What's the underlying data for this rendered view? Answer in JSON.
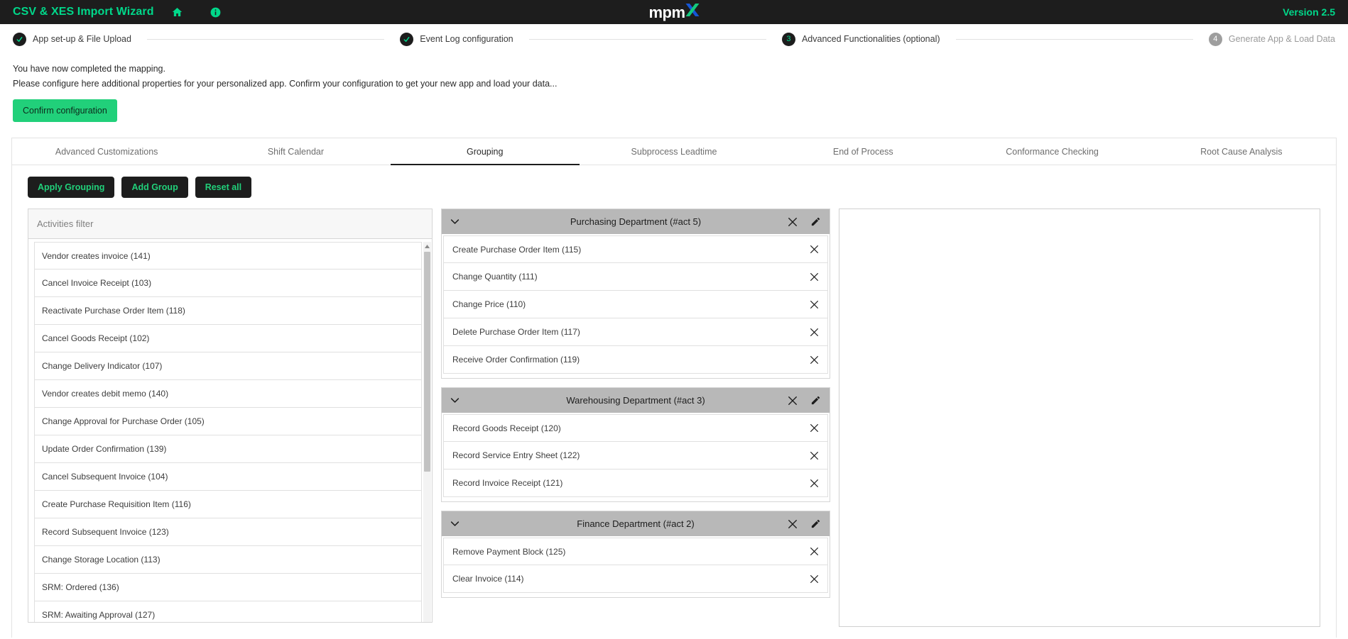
{
  "topbar": {
    "app_title": "CSV & XES Import Wizard",
    "home_icon": "home-icon",
    "info_icon": "info-icon",
    "logo_text": "mpm",
    "logo_x": "X",
    "version": "Version 2.5",
    "bg_color": "#1d1d1d",
    "accent_color": "#00d88a"
  },
  "stepper": {
    "steps": [
      {
        "marker": "✓",
        "label": "App set-up & File Upload",
        "state": "done"
      },
      {
        "marker": "✓",
        "label": "Event Log configuration",
        "state": "done"
      },
      {
        "marker": "3",
        "label": "Advanced Functionalities (optional)",
        "state": "current"
      },
      {
        "marker": "4",
        "label": "Generate App & Load Data",
        "state": "upcoming"
      }
    ]
  },
  "intro": {
    "line1": "You have now completed the mapping.",
    "line2": "Please configure here additional properties for your personalized app. Confirm your configuration to get your new app and load your data...",
    "confirm_label": "Confirm configuration"
  },
  "tabs": [
    {
      "label": "Advanced Customizations",
      "active": false
    },
    {
      "label": "Shift Calendar",
      "active": false
    },
    {
      "label": "Grouping",
      "active": true
    },
    {
      "label": "Subprocess Leadtime",
      "active": false
    },
    {
      "label": "End of Process",
      "active": false
    },
    {
      "label": "Conformance Checking",
      "active": false
    },
    {
      "label": "Root Cause Analysis",
      "active": false
    }
  ],
  "toolbar": {
    "apply_grouping_label": "Apply Grouping",
    "add_group_label": "Add Group",
    "reset_all_label": "Reset all"
  },
  "activities": {
    "header": "Activities filter",
    "items": [
      "Vendor creates invoice (141)",
      "Cancel Invoice Receipt (103)",
      "Reactivate Purchase Order Item (118)",
      "Cancel Goods Receipt (102)",
      "Change Delivery Indicator (107)",
      "Vendor creates debit memo (140)",
      "Change Approval for Purchase Order (105)",
      "Update Order Confirmation (139)",
      "Cancel Subsequent Invoice (104)",
      "Create Purchase Requisition Item (116)",
      "Record Subsequent Invoice (123)",
      "Change Storage Location (113)",
      "SRM: Ordered (136)",
      "SRM: Awaiting Approval (127)"
    ]
  },
  "groups": [
    {
      "title": "Purchasing Department (#act 5)",
      "items": [
        "Create Purchase Order Item (115)",
        "Change Quantity (111)",
        "Change Price (110)",
        "Delete Purchase Order Item (117)",
        "Receive Order Confirmation (119)"
      ]
    },
    {
      "title": "Warehousing Department (#act 3)",
      "items": [
        "Record Goods Receipt (120)",
        "Record Service Entry Sheet (122)",
        "Record Invoice Receipt (121)"
      ]
    },
    {
      "title": "Finance Department (#act 2)",
      "items": [
        "Remove Payment Block (125)",
        "Clear Invoice (114)"
      ]
    }
  ]
}
